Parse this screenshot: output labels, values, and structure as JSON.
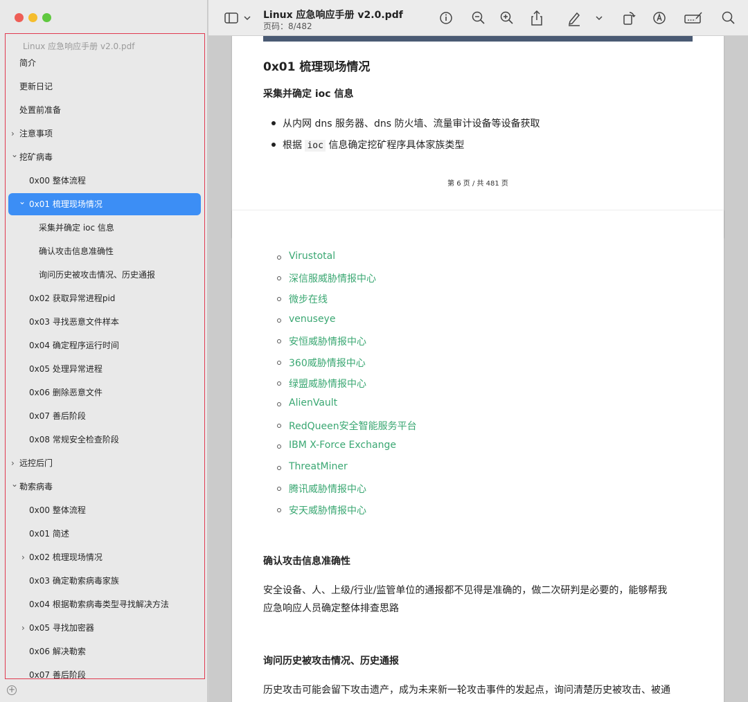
{
  "window": {
    "doc_title": "Linux 应急响应手册 v2.0.pdf",
    "page_indicator": "页码：8/482"
  },
  "sidebar": {
    "outline_title": "Linux 应急响应手册 v2.0.pdf",
    "items": [
      {
        "label": "简介"
      },
      {
        "label": "更新日记"
      },
      {
        "label": "处置前准备"
      },
      {
        "label": "注意事项",
        "chevron": "›"
      },
      {
        "label": "挖矿病毒",
        "chevron": "⌄"
      },
      {
        "label": "0x00 整体流程"
      },
      {
        "label": "0x01 梳理现场情况",
        "chevron": "⌄"
      },
      {
        "label": "采集并确定 ioc 信息"
      },
      {
        "label": "确认攻击信息准确性"
      },
      {
        "label": "询问历史被攻击情况、历史通报"
      },
      {
        "label": "0x02 获取异常进程pid"
      },
      {
        "label": "0x03 寻找恶意文件样本"
      },
      {
        "label": "0x04 确定程序运行时间"
      },
      {
        "label": "0x05 处理异常进程"
      },
      {
        "label": "0x06 删除恶意文件"
      },
      {
        "label": "0x07 善后阶段"
      },
      {
        "label": "0x08 常规安全检查阶段"
      },
      {
        "label": "远控后门",
        "chevron": "›"
      },
      {
        "label": "勒索病毒",
        "chevron": "⌄"
      },
      {
        "label": "0x00 整体流程"
      },
      {
        "label": "0x01 简述"
      },
      {
        "label": "0x02 梳理现场情况",
        "chevron": "›"
      },
      {
        "label": "0x03 确定勒索病毒家族"
      },
      {
        "label": "0x04 根据勒索病毒类型寻找解决方法"
      },
      {
        "label": "0x05 寻找加密器",
        "chevron": "›"
      },
      {
        "label": "0x06 解决勒索"
      },
      {
        "label": "0x07 善后阶段"
      }
    ],
    "add_symbol": "+"
  },
  "toolbar": {
    "icons": [
      "sidebar-toggle-icon",
      "chevron-down-icon",
      "info-icon",
      "zoom-out-icon",
      "zoom-in-icon",
      "share-icon",
      "highlight-icon",
      "chevron-down-icon",
      "rotate-icon",
      "markup-icon",
      "signature-icon",
      "search-icon"
    ]
  },
  "page1": {
    "heading": "0x01 梳理现场情况",
    "subheading": "采集并确定 ioc 信息",
    "bullet1": "从内网 dns 服务器、dns 防火墙、流量审计设备等设备获取",
    "bullet2_pre": "根据 ",
    "bullet2_code": "ioc",
    "bullet2_post": " 信息确定挖矿程序具体家族类型",
    "footer": "第 6 页 / 共 481 页"
  },
  "page2": {
    "links": [
      "Virustotal",
      "深信服威胁情报中心",
      "微步在线",
      "venuseye",
      "安恒威胁情报中心",
      "360威胁情报中心",
      "绿盟威胁情报中心",
      "AlienVault",
      "RedQueen安全智能服务平台",
      "IBM X-Force Exchange",
      "ThreatMiner",
      "腾讯威胁情报中心",
      "安天威胁情报中心"
    ],
    "section1_title": "确认攻击信息准确性",
    "section1_text_line1": "安全设备、人、上级/行业/监管单位的通报都不见得是准确的，做二次研判是必要的，能够帮我",
    "section1_text_line2": "应急响应人员确定整体排查思路",
    "section2_title": "询问历史被攻击情况、历史通报",
    "section2_text_line1": "历史攻击可能会留下攻击遗产，成为未来新一轮攻击事件的发起点，询问清楚历史被攻击、被通"
  },
  "colors": {
    "accent": "#3c8ef5",
    "link": "#3aa772",
    "outline_border": "#e0394f"
  }
}
